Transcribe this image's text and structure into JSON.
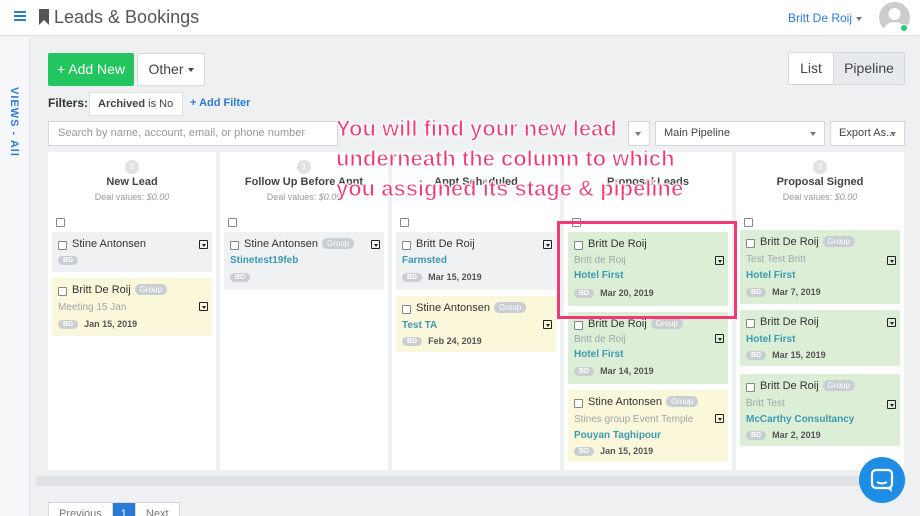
{
  "app": {
    "title": "Leads & Bookings",
    "user_name": "Britt De Roij"
  },
  "sidebar": {
    "views_label": "VIEWS - All"
  },
  "toolbar": {
    "add_new": "+ Add New",
    "other": "Other",
    "list": "List",
    "pipeline": "Pipeline"
  },
  "filters": {
    "label": "Filters:",
    "chip_field": "Archived",
    "chip_value": " is No",
    "add_filter": "+ Add Filter"
  },
  "search": {
    "placeholder": "Search by name, account, email, or phone number",
    "pipeline_select": "Main Pipeline",
    "export": "Export As..."
  },
  "columns": [
    {
      "count": "2",
      "title": "New Lead",
      "deal_label": "Deal values: ",
      "deal_value": "$0.00"
    },
    {
      "count": "1",
      "title": "Follow Up Before Appt",
      "deal_label": "Deal values: ",
      "deal_value": "$0.00"
    },
    {
      "count": "",
      "title": "Appt Scheduled",
      "deal_label": "",
      "deal_value": ""
    },
    {
      "count": "",
      "title": "Proposal Leads",
      "deal_label": "",
      "deal_value": ""
    },
    {
      "count": "3",
      "title": "Proposal Signed",
      "deal_label": "Deal values: ",
      "deal_value": "$0.00"
    }
  ],
  "cards": {
    "c1a": {
      "name": "Stine Antonsen",
      "bd": "BD"
    },
    "c1b": {
      "name": "Britt De Roij",
      "badge": "Group",
      "sub": "Meeting 15 Jan",
      "bd": "BD",
      "date": "Jan 15, 2019"
    },
    "c2a": {
      "name": "Stine Antonsen",
      "badge": "Group",
      "link": "Stinetest19feb",
      "bd": "BD"
    },
    "c3a": {
      "name": "Britt De Roij",
      "link": "Farmsted",
      "bd": "BD",
      "date": "Mar 15, 2019"
    },
    "c3b": {
      "name": "Stine Antonsen",
      "badge": "Group",
      "link": "Test TA",
      "bd": "BD",
      "date": "Feb 24, 2019"
    },
    "c4a": {
      "name": "Britt De Roij",
      "sub": "Britt de Roij",
      "link": "Hotel First",
      "bd": "BD",
      "date": "Mar 20, 2019"
    },
    "c4b": {
      "name": "Britt De Roij",
      "badge": "Group",
      "sub": "Britt de Roij",
      "link": "Hotel First",
      "bd": "BD",
      "date": "Mar 14, 2019"
    },
    "c4c": {
      "name": "Stine Antonsen",
      "badge": "Group",
      "sub": "Stines group Event Temple",
      "link": "Pouyan Taghipour",
      "bd": "BD",
      "date": "Jan 15, 2019"
    },
    "c5a": {
      "name": "Britt De Roij",
      "badge": "Group",
      "sub": "Test Test Britt",
      "link": "Hotel First",
      "bd": "BD",
      "date": "Mar 7, 2019"
    },
    "c5b": {
      "name": "Britt De Roij",
      "link": "Hotel First",
      "bd": "BD",
      "date": "Mar 15, 2019"
    },
    "c5c": {
      "name": "Britt De Roij",
      "badge": "Group",
      "sub": "Britt Test",
      "link": "McCarthy Consultancy",
      "bd": "BD",
      "date": "Mar 2, 2019"
    }
  },
  "annotation": {
    "line1": "You will find your new lead",
    "line2": "underneath the column to which",
    "line3": "you assigned its stage & pipeline",
    "color": "#f13a73"
  },
  "pagination": {
    "previous": "Previous",
    "page": "1",
    "next": "Next"
  },
  "colors": {
    "brand_blue": "#2b7bd4",
    "add_green": "#23c55e",
    "card_green": "#dcefd6",
    "card_yellow": "#fbf7da",
    "card_gray": "#f0f1f3"
  }
}
